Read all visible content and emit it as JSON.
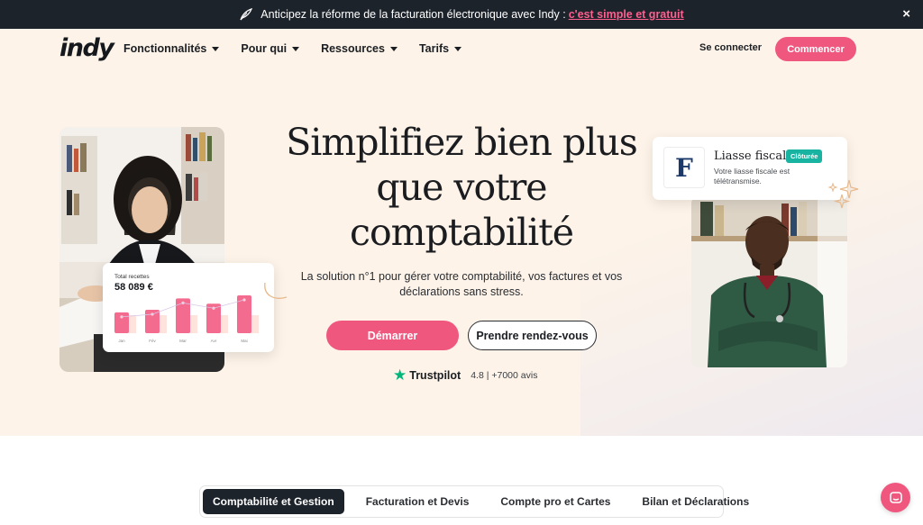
{
  "banner": {
    "text": "Anticipez la réforme de la facturation électronique avec Indy :",
    "link": "c'est simple et gratuit",
    "close": "×"
  },
  "nav": {
    "logo": "indy",
    "items": [
      {
        "label": "Fonctionnalités"
      },
      {
        "label": "Pour qui"
      },
      {
        "label": "Ressources"
      },
      {
        "label": "Tarifs"
      }
    ],
    "login": "Se connecter",
    "cta": "Commencer"
  },
  "hero": {
    "headline_lines": [
      "Simplifiez bien plus",
      "que votre",
      "comptabilité"
    ],
    "subtitle": "La solution n°1 pour gérer votre comptabilité, vos factures et vos déclarations sans stress.",
    "primary_cta": "Démarrer",
    "secondary_cta": "Prendre rendez-vous",
    "trustpilot": {
      "brand": "Trustpilot",
      "rating": "4.8 | +7000 avis"
    }
  },
  "recettes_card": {
    "label": "Total recettes",
    "amount": "58 089 €",
    "months": [
      "Jan",
      "Fév",
      "Mar",
      "Avr",
      "Mai"
    ],
    "chart_data": {
      "type": "bar",
      "categories": [
        "Jan",
        "Fév",
        "Mar",
        "Avr",
        "Mai"
      ],
      "series": [
        {
          "values": [
            0.55,
            0.62,
            0.92,
            0.78,
            1.0
          ]
        }
      ]
    }
  },
  "liasse_card": {
    "logo_letter": "F",
    "title": "Liasse fiscale",
    "badge": "Clôturée",
    "description": "Votre liasse fiscale est télétransmise."
  },
  "tabs": [
    {
      "label": "Comptabilité et Gestion",
      "active": true
    },
    {
      "label": "Facturation et Devis",
      "active": false
    },
    {
      "label": "Compte pro et Cartes",
      "active": false
    },
    {
      "label": "Bilan et Déclarations",
      "active": false
    }
  ],
  "colors": {
    "brand_pink": "#f0577f",
    "banner_bg": "#1d232b",
    "hero_bg": "#fdf3e8",
    "trustpilot_green": "#00b67a",
    "badge_teal": "#19b3a2"
  },
  "icons": {
    "banner_leaf": "leaf-icon",
    "close": "close-icon",
    "chat": "chat-icon",
    "star": "star-icon"
  }
}
